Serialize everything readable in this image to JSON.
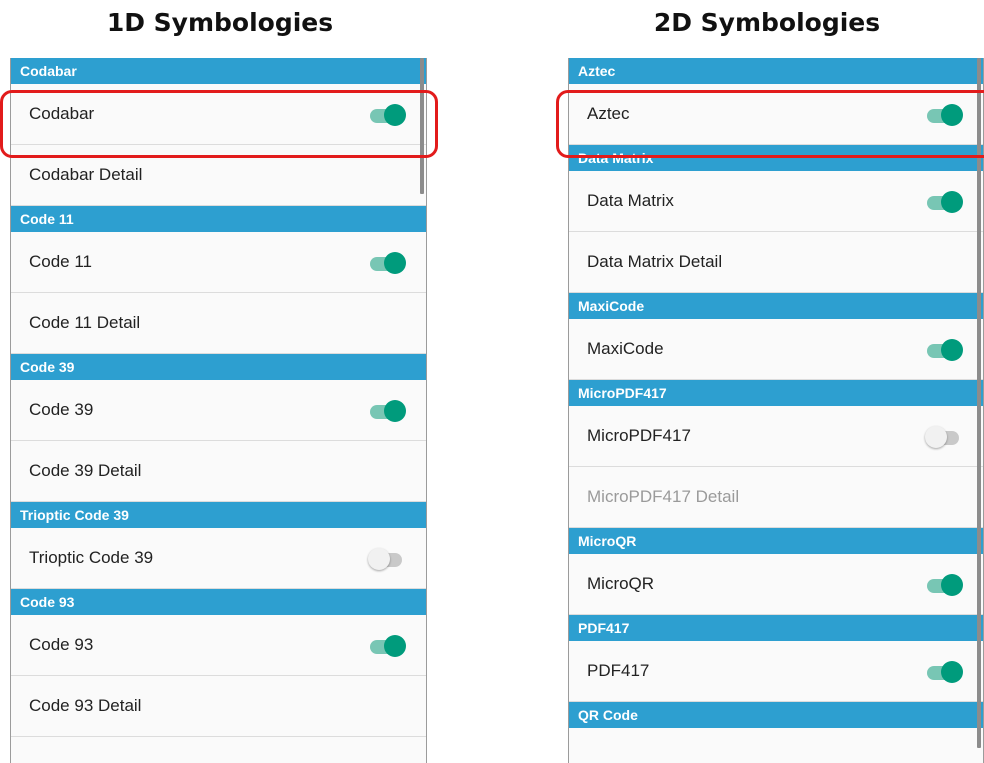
{
  "panels": {
    "left": {
      "title": "1D Symbologies",
      "sections": [
        {
          "header": "Codabar",
          "items": [
            {
              "label": "Codabar",
              "toggle": true
            },
            {
              "label": "Codabar Detail"
            }
          ]
        },
        {
          "header": "Code 11",
          "items": [
            {
              "label": "Code 11",
              "toggle": true
            },
            {
              "label": "Code 11 Detail"
            }
          ]
        },
        {
          "header": "Code 39",
          "items": [
            {
              "label": "Code 39",
              "toggle": true
            },
            {
              "label": "Code 39 Detail"
            }
          ]
        },
        {
          "header": "Trioptic Code 39",
          "items": [
            {
              "label": "Trioptic Code 39",
              "toggle": false
            }
          ]
        },
        {
          "header": "Code 93",
          "items": [
            {
              "label": "Code 93",
              "toggle": true
            },
            {
              "label": "Code 93 Detail"
            }
          ]
        }
      ]
    },
    "right": {
      "title": "2D Symbologies",
      "sections": [
        {
          "header": "Aztec",
          "items": [
            {
              "label": "Aztec",
              "toggle": true
            }
          ]
        },
        {
          "header": "Data Matrix",
          "items": [
            {
              "label": "Data Matrix",
              "toggle": true
            },
            {
              "label": "Data Matrix Detail"
            }
          ]
        },
        {
          "header": "MaxiCode",
          "items": [
            {
              "label": "MaxiCode",
              "toggle": true
            }
          ]
        },
        {
          "header": "MicroPDF417",
          "items": [
            {
              "label": "MicroPDF417",
              "toggle": false
            },
            {
              "label": "MicroPDF417 Detail",
              "disabled": true
            }
          ]
        },
        {
          "header": "MicroQR",
          "items": [
            {
              "label": "MicroQR",
              "toggle": true
            }
          ]
        },
        {
          "header": "PDF417",
          "items": [
            {
              "label": "PDF417",
              "toggle": true
            }
          ]
        },
        {
          "header": "QR Code",
          "items": []
        }
      ]
    }
  },
  "colors": {
    "header_bg": "#2d9fd0",
    "toggle_on": "#009b7c",
    "toggle_off": "#f1f1f1",
    "highlight": "#e21b1b"
  }
}
